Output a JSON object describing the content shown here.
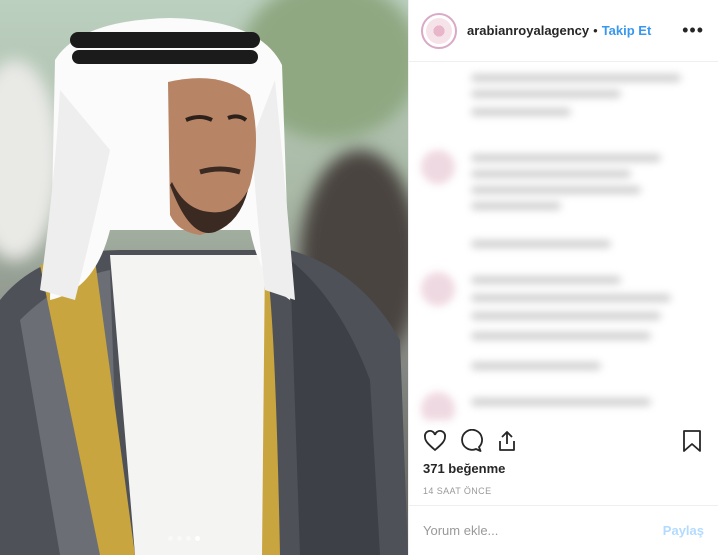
{
  "header": {
    "username": "arabianroyalagency",
    "separator": "•",
    "follow_label": "Takip Et",
    "more_icon": "more-horizontal-icon"
  },
  "actions": {
    "like_icon": "heart-icon",
    "comment_icon": "comment-icon",
    "share_icon": "share-icon",
    "save_icon": "bookmark-icon"
  },
  "likes_text": "371 beğenme",
  "timestamp": "14 SAAT ÖNCE",
  "comment_box": {
    "placeholder": "Yorum ekle...",
    "post_label": "Paylaş"
  },
  "carousel": {
    "count": 4,
    "active_index": 3
  },
  "colors": {
    "follow": "#3897f0",
    "post_disabled": "#b3dbff",
    "text": "#262626",
    "muted": "#999999"
  }
}
